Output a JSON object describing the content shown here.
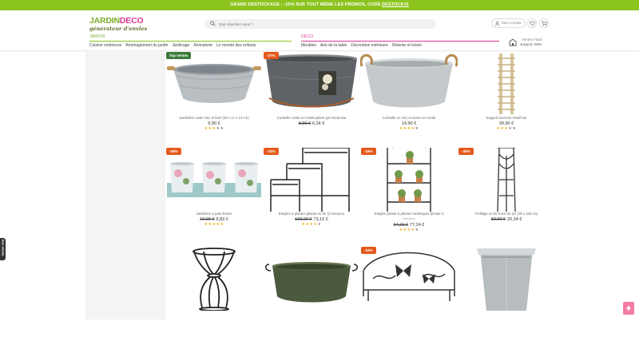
{
  "promo": {
    "text": "GRAND DESTOCKAGE : -15% SUR TOUT MÊME LES PROMOS, CODE ",
    "code": "DESTOCK15"
  },
  "brand": {
    "name_part1": "JARDIN",
    "name_part2": "DECO",
    "tagline": "générateur d'envies"
  },
  "search": {
    "placeholder": "Que cherchez-vous ?"
  },
  "account": {
    "label": "Mon compte"
  },
  "nav": {
    "jardin": {
      "title": "JARDIN",
      "items": [
        "Cuisine extérieure",
        "Aménagement du jardin",
        "Jardinage",
        "Animalerie",
        "Le monde des enfants"
      ]
    },
    "deco": {
      "title": "DÉCO",
      "items": [
        "Meubles",
        "Arts de la table",
        "Décoration intérieure",
        "Détente et loisirs"
      ]
    }
  },
  "store": {
    "line1": "Ventes Flash",
    "line2": "Jusqu'à -60%"
  },
  "products": [
    {
      "badge": "Top ventes",
      "name": "Jardinière ovale zinc et bois (30 x 17 x 14 cm)",
      "old_price": "",
      "price": "6,90 €",
      "rating": 3
    },
    {
      "badge": "-37%",
      "name": "Corbeille ronde en métal patiné gris hortensia",
      "old_price": "9,90 €",
      "price": "6,24 €",
      "rating": 0
    },
    {
      "badge": "",
      "name": "Corbeille en zinc et anses en corde",
      "old_price": "",
      "price": "14,90 €",
      "rating": 4
    },
    {
      "badge": "",
      "name": "Support tournant rotatif bar",
      "old_price": "",
      "price": "39,90 €",
      "rating": 3
    },
    {
      "badge": "-38%",
      "name": "Jardinière 3 pots Roses",
      "old_price": "10,90 €",
      "price": "6,83 €",
      "rating": 5
    },
    {
      "badge": "-33%",
      "name": "Etagère à plantes pliante en fer (3 niveaux)",
      "old_price": "109,90 €",
      "price": "73,16 €",
      "rating": 4
    },
    {
      "badge": "-18%",
      "name": "Etagère plante à plantes Atelesques (Droite 3",
      "sub": "niveaux)",
      "old_price": "94,20 €",
      "price": "77,24 €",
      "rating": 4
    },
    {
      "badge": "-40%",
      "name": "Treillage en fer forcé de lys (28 x 128 cm)",
      "old_price": "33,90 €",
      "price": "20,34 €",
      "rating": 0
    },
    {
      "badge": "",
      "name": "",
      "old_price": "",
      "price": "",
      "rating": 0
    },
    {
      "badge": "",
      "name": "",
      "old_price": "",
      "price": "",
      "rating": 0
    },
    {
      "badge": "-33%",
      "name": "",
      "old_price": "",
      "price": "",
      "rating": 0
    },
    {
      "badge": "",
      "name": "",
      "old_price": "",
      "price": "",
      "rating": 0
    }
  ],
  "avis_tab": {
    "label": "Avis clients"
  },
  "colors": {
    "green": "#8cc41e",
    "pink": "#d53a93",
    "orange": "#e45a1c",
    "badge_green": "#3c7a3a"
  },
  "icons": [
    "search-icon",
    "user-icon",
    "heart-icon",
    "cart-icon",
    "store-icon",
    "arrow-up-icon"
  ]
}
